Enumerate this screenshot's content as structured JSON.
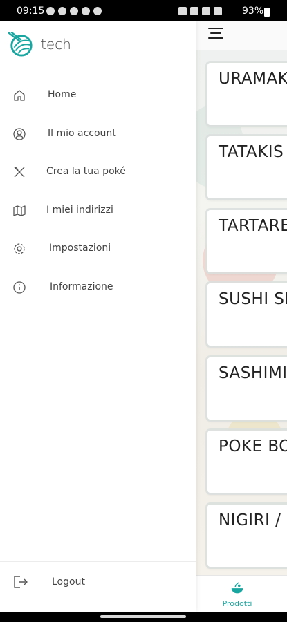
{
  "status_bar": {
    "time": "09:15",
    "battery_percent": "93%"
  },
  "drawer": {
    "brand_name": "tech",
    "items": [
      {
        "label": "Home",
        "icon": "home-icon"
      },
      {
        "label": "Il mio account",
        "icon": "account-icon"
      },
      {
        "label": "Crea la tua poké",
        "icon": "chopsticks-icon"
      },
      {
        "label": "I miei indirizzi",
        "icon": "map-icon"
      },
      {
        "label": "Impostazioni",
        "icon": "gear-icon"
      },
      {
        "label": "Informazione",
        "icon": "info-icon"
      }
    ],
    "logout_label": "Logout"
  },
  "main": {
    "categories": [
      "URAMAKI",
      "TATAKIS",
      "TARTARE",
      "SUSHI SE",
      "SASHIMI",
      "POKE BO",
      "NIGIRI /"
    ],
    "bottom_nav": {
      "active_tab_label": "Prodotti"
    }
  },
  "colors": {
    "accent": "#1aa6a0",
    "text": "#444444"
  }
}
